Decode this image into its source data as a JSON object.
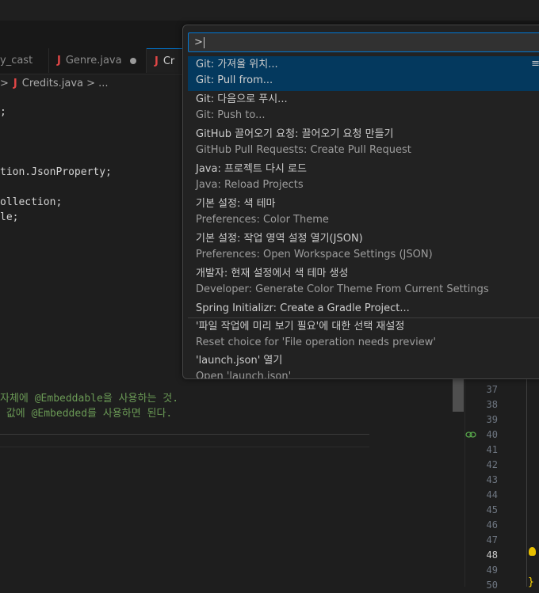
{
  "tabs": [
    {
      "label": "y_cast"
    },
    {
      "label": "Genre.java"
    },
    {
      "label": "Cr"
    }
  ],
  "breadcrumb": {
    "sep": ">",
    "file": "Credits.java",
    "more": "> ..."
  },
  "code_lines": [
    ";",
    "tion.JsonProperty;",
    "ollection;",
    "le;"
  ],
  "comments": [
    {
      "pre": "자체에 ",
      "ann": "@Embeddable",
      "post": "을 사용하는 것."
    },
    {
      "pre": " 값에 ",
      "ann": "@Embedded",
      "post": "를 사용하면 된다."
    }
  ],
  "line_numbers": [
    "37",
    "38",
    "39",
    "40",
    "41",
    "42",
    "43",
    "44",
    "45",
    "46",
    "47",
    "48",
    "49",
    "50"
  ],
  "current_line": "48",
  "brace": "}",
  "command_palette": {
    "input_value": ">",
    "items": [
      {
        "label": "Git: 가져올 위치...",
        "detail": "Git: Pull from...",
        "selected": true
      },
      {
        "label": "Git: 다음으로 푸시...",
        "detail": "Git: Push to..."
      },
      {
        "label": "GitHub 끌어오기 요청: 끌어오기 요청 만들기",
        "detail": "GitHub Pull Requests: Create Pull Request"
      },
      {
        "label": "Java: 프로젝트 다시 로드",
        "detail": "Java: Reload Projects"
      },
      {
        "label": "기본 설정: 색 테마",
        "detail": "Preferences: Color Theme"
      },
      {
        "label": "기본 설정: 작업 영역 설정 열기(JSON)",
        "detail": "Preferences: Open Workspace Settings (JSON)"
      },
      {
        "label": "개발자: 현재 설정에서 색 테마 생성",
        "detail": "Developer: Generate Color Theme From Current Settings"
      },
      {
        "label": "Spring Initializr: Create a Gradle Project..."
      },
      {
        "label": "'파일 작업에 미리 보기 필요'에 대한 선택 재설정",
        "detail": "Reset choice for 'File operation needs preview'"
      },
      {
        "label": "'launch.json' 열기",
        "detail": "Open 'launch.json'"
      }
    ]
  },
  "colors": {
    "accent": "#0078d4",
    "selected_bg": "#04395e",
    "comment": "#6a9955",
    "java_icon": "#e04646"
  },
  "icons": {
    "java": "J",
    "link": "link-icon",
    "bulb": "lightbulb-icon"
  }
}
